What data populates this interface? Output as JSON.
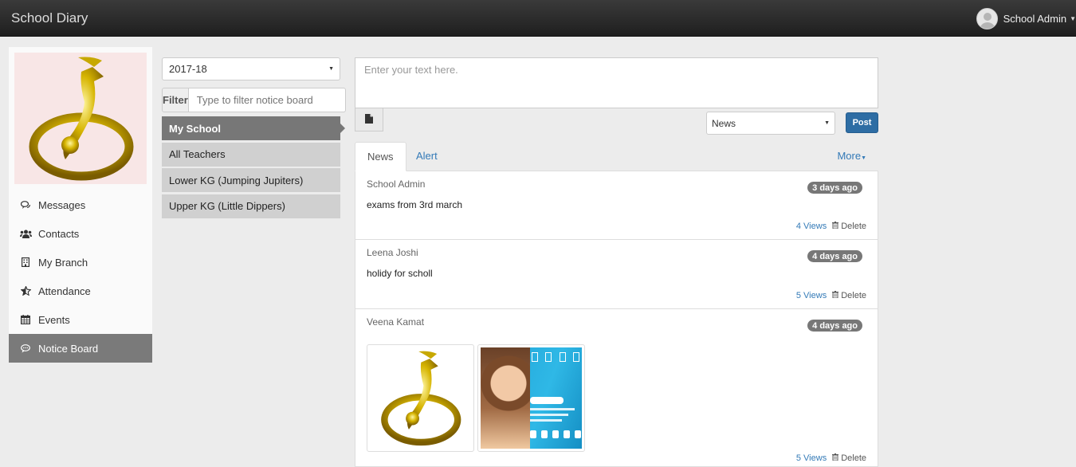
{
  "app": {
    "title": "School Diary",
    "user_name": "School Admin"
  },
  "sidebar": {
    "items": [
      {
        "label": "Messages",
        "icon": "comments-icon"
      },
      {
        "label": "Contacts",
        "icon": "users-icon"
      },
      {
        "label": "My Branch",
        "icon": "building-icon"
      },
      {
        "label": "Attendance",
        "icon": "star-icon"
      },
      {
        "label": "Events",
        "icon": "calendar-icon"
      },
      {
        "label": "Notice Board",
        "icon": "comment-icon",
        "active": true
      }
    ]
  },
  "filters": {
    "year": "2017-18",
    "filter_label": "Filter",
    "filter_placeholder": "Type to filter notice board",
    "boards": [
      {
        "label": "My School",
        "active": true
      },
      {
        "label": "All Teachers"
      },
      {
        "label": "Lower KG (Jumping Jupiters)"
      },
      {
        "label": "Upper KG (Little Dippers)"
      }
    ]
  },
  "composer": {
    "placeholder": "Enter your text here.",
    "type_value": "News",
    "post_label": "Post"
  },
  "tabs": {
    "news": "News",
    "alert": "Alert",
    "more": "More"
  },
  "posts": [
    {
      "author": "School Admin",
      "age": "3 days ago",
      "text": "exams from 3rd march",
      "views": "4 Views",
      "delete": "Delete"
    },
    {
      "author": "Leena Joshi",
      "age": "4 days ago",
      "text": "holidy for scholl",
      "views": "5 Views",
      "delete": "Delete"
    },
    {
      "author": "Veena Kamat",
      "age": "4 days ago",
      "text": "",
      "views": "5 Views",
      "delete": "Delete"
    }
  ],
  "colors": {
    "topbar": "#2a2a2a",
    "active_item": "#7a7a7a",
    "primary_button": "#2e6da4",
    "link": "#337ab7",
    "badge": "#777777"
  }
}
